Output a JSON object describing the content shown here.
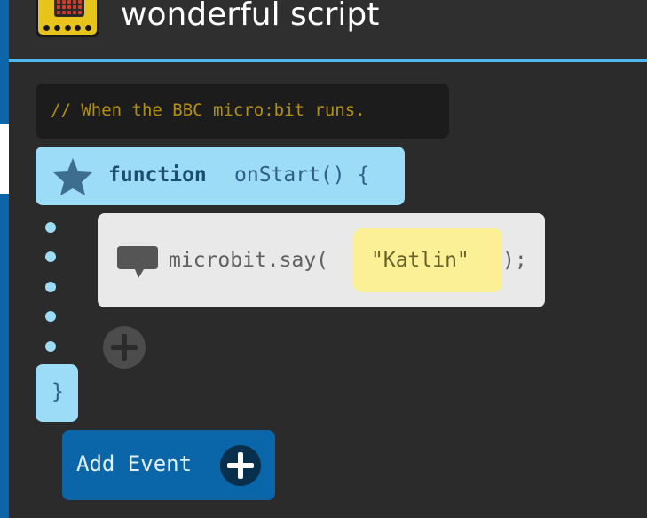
{
  "header": {
    "title": "wonderful script",
    "app_icon": "microbit-board-icon"
  },
  "colors": {
    "background": "#2b2b2b",
    "accent": "#4db8ee",
    "function_block": "#9ddcf7",
    "statement_block": "#e9e9e9",
    "string_literal": "#fbf095",
    "comment_text": "#b4900c",
    "add_event": "#0a66a8"
  },
  "script": {
    "comment": "// When the BBC micro:bit runs.",
    "function_keyword": "function",
    "function_signature": "onStart() {",
    "statement": {
      "call": "microbit.say(",
      "argument": "\"Katlin\"",
      "close": ");"
    },
    "close_brace": "}",
    "icons": {
      "function": "star-icon",
      "statement": "speech-bubble-icon",
      "add_statement": "plus-icon"
    }
  },
  "actions": {
    "add_event_label": "Add Event"
  }
}
